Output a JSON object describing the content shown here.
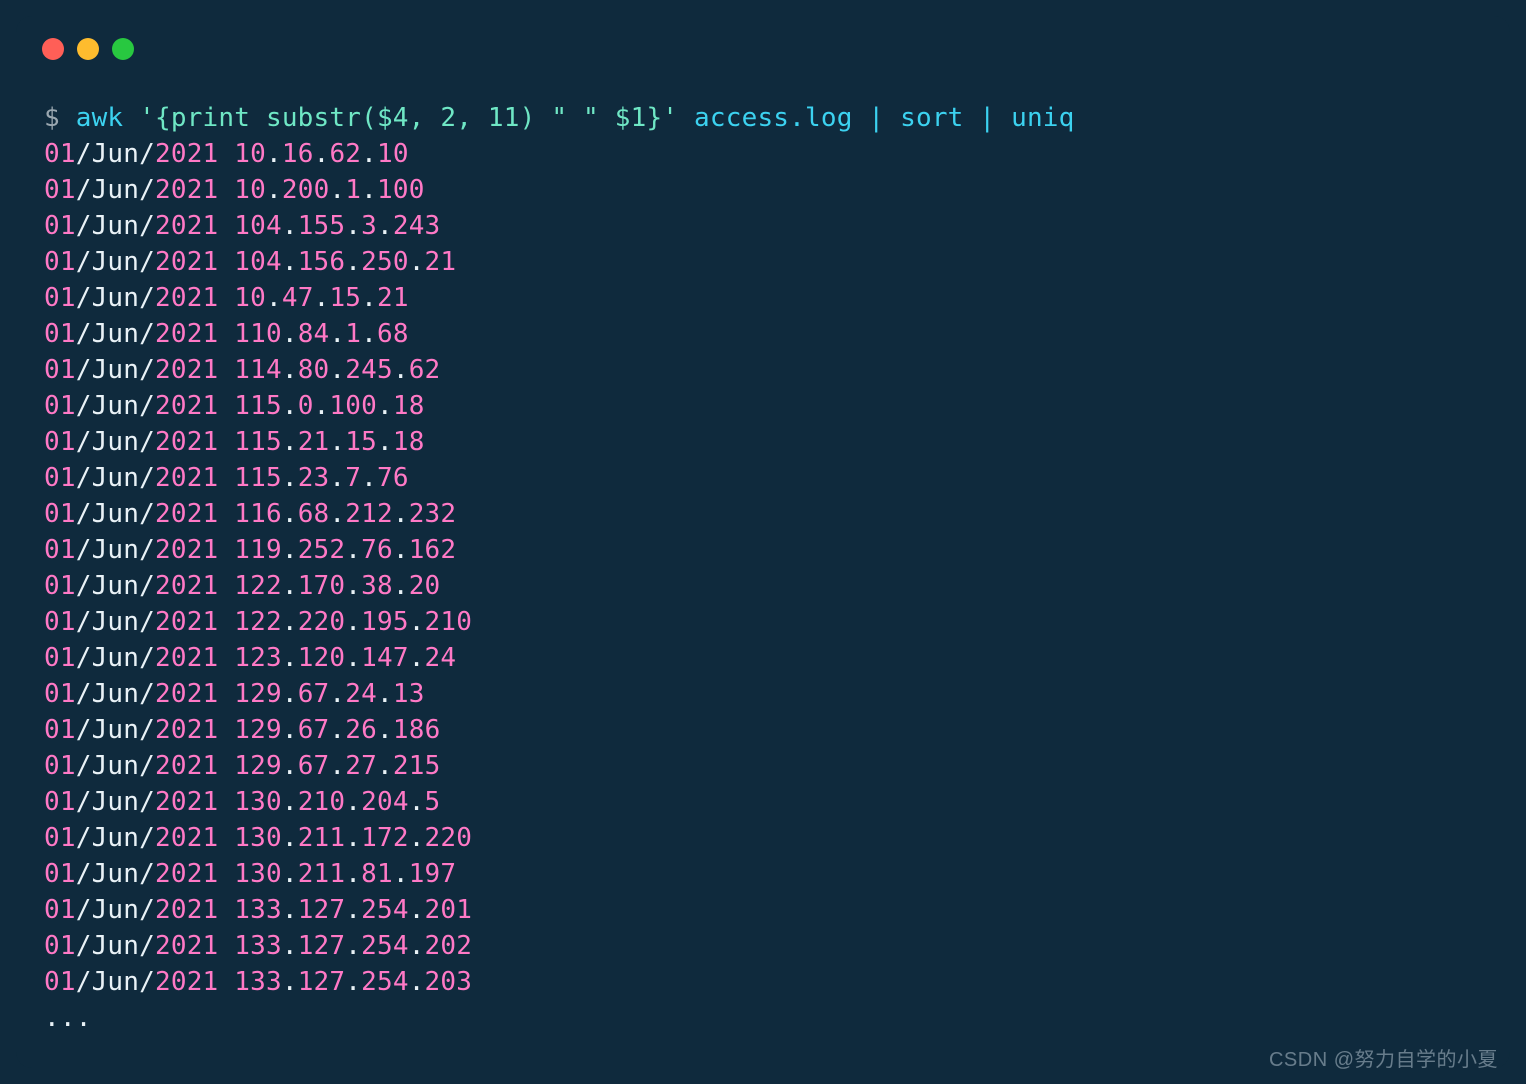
{
  "titlebar": {
    "close": "close",
    "minimize": "minimize",
    "zoom": "zoom"
  },
  "prompt": {
    "symbol": "$ ",
    "cmd1": "awk ",
    "arg_open": "'{print substr($4, 2, 11) ",
    "arg_mid": "\" \"",
    "arg_close": " $1}'",
    "rest": " access.log | sort | uniq"
  },
  "lines": [
    {
      "day": "01",
      "sep1": "/Jun/",
      "year": "2021",
      "sp": " ",
      "o1": "10",
      "d1": ".",
      "o2": "16",
      "d2": ".",
      "o3": "62",
      "d3": ".",
      "o4": "10"
    },
    {
      "day": "01",
      "sep1": "/Jun/",
      "year": "2021",
      "sp": " ",
      "o1": "10",
      "d1": ".",
      "o2": "200",
      "d2": ".",
      "o3": "1",
      "d3": ".",
      "o4": "100"
    },
    {
      "day": "01",
      "sep1": "/Jun/",
      "year": "2021",
      "sp": " ",
      "o1": "104",
      "d1": ".",
      "o2": "155",
      "d2": ".",
      "o3": "3",
      "d3": ".",
      "o4": "243"
    },
    {
      "day": "01",
      "sep1": "/Jun/",
      "year": "2021",
      "sp": " ",
      "o1": "104",
      "d1": ".",
      "o2": "156",
      "d2": ".",
      "o3": "250",
      "d3": ".",
      "o4": "21"
    },
    {
      "day": "01",
      "sep1": "/Jun/",
      "year": "2021",
      "sp": " ",
      "o1": "10",
      "d1": ".",
      "o2": "47",
      "d2": ".",
      "o3": "15",
      "d3": ".",
      "o4": "21"
    },
    {
      "day": "01",
      "sep1": "/Jun/",
      "year": "2021",
      "sp": " ",
      "o1": "110",
      "d1": ".",
      "o2": "84",
      "d2": ".",
      "o3": "1",
      "d3": ".",
      "o4": "68"
    },
    {
      "day": "01",
      "sep1": "/Jun/",
      "year": "2021",
      "sp": " ",
      "o1": "114",
      "d1": ".",
      "o2": "80",
      "d2": ".",
      "o3": "245",
      "d3": ".",
      "o4": "62"
    },
    {
      "day": "01",
      "sep1": "/Jun/",
      "year": "2021",
      "sp": " ",
      "o1": "115",
      "d1": ".",
      "o2": "0",
      "d2": ".",
      "o3": "100",
      "d3": ".",
      "o4": "18"
    },
    {
      "day": "01",
      "sep1": "/Jun/",
      "year": "2021",
      "sp": " ",
      "o1": "115",
      "d1": ".",
      "o2": "21",
      "d2": ".",
      "o3": "15",
      "d3": ".",
      "o4": "18"
    },
    {
      "day": "01",
      "sep1": "/Jun/",
      "year": "2021",
      "sp": " ",
      "o1": "115",
      "d1": ".",
      "o2": "23",
      "d2": ".",
      "o3": "7",
      "d3": ".",
      "o4": "76"
    },
    {
      "day": "01",
      "sep1": "/Jun/",
      "year": "2021",
      "sp": " ",
      "o1": "116",
      "d1": ".",
      "o2": "68",
      "d2": ".",
      "o3": "212",
      "d3": ".",
      "o4": "232"
    },
    {
      "day": "01",
      "sep1": "/Jun/",
      "year": "2021",
      "sp": " ",
      "o1": "119",
      "d1": ".",
      "o2": "252",
      "d2": ".",
      "o3": "76",
      "d3": ".",
      "o4": "162"
    },
    {
      "day": "01",
      "sep1": "/Jun/",
      "year": "2021",
      "sp": " ",
      "o1": "122",
      "d1": ".",
      "o2": "170",
      "d2": ".",
      "o3": "38",
      "d3": ".",
      "o4": "20"
    },
    {
      "day": "01",
      "sep1": "/Jun/",
      "year": "2021",
      "sp": " ",
      "o1": "122",
      "d1": ".",
      "o2": "220",
      "d2": ".",
      "o3": "195",
      "d3": ".",
      "o4": "210"
    },
    {
      "day": "01",
      "sep1": "/Jun/",
      "year": "2021",
      "sp": " ",
      "o1": "123",
      "d1": ".",
      "o2": "120",
      "d2": ".",
      "o3": "147",
      "d3": ".",
      "o4": "24"
    },
    {
      "day": "01",
      "sep1": "/Jun/",
      "year": "2021",
      "sp": " ",
      "o1": "129",
      "d1": ".",
      "o2": "67",
      "d2": ".",
      "o3": "24",
      "d3": ".",
      "o4": "13"
    },
    {
      "day": "01",
      "sep1": "/Jun/",
      "year": "2021",
      "sp": " ",
      "o1": "129",
      "d1": ".",
      "o2": "67",
      "d2": ".",
      "o3": "26",
      "d3": ".",
      "o4": "186"
    },
    {
      "day": "01",
      "sep1": "/Jun/",
      "year": "2021",
      "sp": " ",
      "o1": "129",
      "d1": ".",
      "o2": "67",
      "d2": ".",
      "o3": "27",
      "d3": ".",
      "o4": "215"
    },
    {
      "day": "01",
      "sep1": "/Jun/",
      "year": "2021",
      "sp": " ",
      "o1": "130",
      "d1": ".",
      "o2": "210",
      "d2": ".",
      "o3": "204",
      "d3": ".",
      "o4": "5"
    },
    {
      "day": "01",
      "sep1": "/Jun/",
      "year": "2021",
      "sp": " ",
      "o1": "130",
      "d1": ".",
      "o2": "211",
      "d2": ".",
      "o3": "172",
      "d3": ".",
      "o4": "220"
    },
    {
      "day": "01",
      "sep1": "/Jun/",
      "year": "2021",
      "sp": " ",
      "o1": "130",
      "d1": ".",
      "o2": "211",
      "d2": ".",
      "o3": "81",
      "d3": ".",
      "o4": "197"
    },
    {
      "day": "01",
      "sep1": "/Jun/",
      "year": "2021",
      "sp": " ",
      "o1": "133",
      "d1": ".",
      "o2": "127",
      "d2": ".",
      "o3": "254",
      "d3": ".",
      "o4": "201"
    },
    {
      "day": "01",
      "sep1": "/Jun/",
      "year": "2021",
      "sp": " ",
      "o1": "133",
      "d1": ".",
      "o2": "127",
      "d2": ".",
      "o3": "254",
      "d3": ".",
      "o4": "202"
    },
    {
      "day": "01",
      "sep1": "/Jun/",
      "year": "2021",
      "sp": " ",
      "o1": "133",
      "d1": ".",
      "o2": "127",
      "d2": ".",
      "o3": "254",
      "d3": ".",
      "o4": "203"
    }
  ],
  "ellipsis": "...",
  "watermark": "CSDN @努力自学的小夏"
}
